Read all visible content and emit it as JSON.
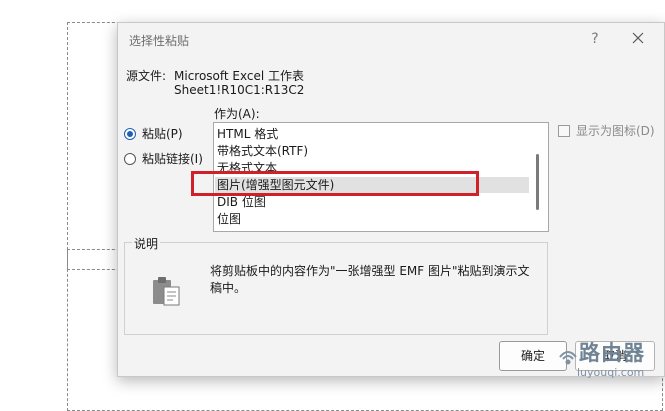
{
  "dialog": {
    "title": "选择性粘贴",
    "help": "?",
    "source_label": "源文件:",
    "source_value": "Microsoft Excel 工作表",
    "source_range": "Sheet1!R10C1:R13C2",
    "as_label": "作为(A):",
    "radios": [
      {
        "label": "粘贴(P)",
        "checked": true
      },
      {
        "label": "粘贴链接(I)",
        "checked": false
      }
    ],
    "list": [
      {
        "label": "HTML 格式",
        "selected": false
      },
      {
        "label": "带格式文本(RTF)",
        "selected": false
      },
      {
        "label": "无格式文本",
        "selected": false
      },
      {
        "label": "图片(增强型图元文件)",
        "selected": true
      },
      {
        "label": "DIB 位图",
        "selected": false
      },
      {
        "label": "位图",
        "selected": false
      }
    ],
    "display_as_icon": "显示为图标(D)",
    "description_label": "说明",
    "description_text": "将剪贴板中的内容作为\"一张增强型 EMF 图片\"粘贴到演示文稿中。",
    "ok": "确定",
    "cancel": "取消"
  },
  "watermark": {
    "text": "路由器",
    "url": "luyouqi.com"
  },
  "colors": {
    "accent": "#1f5fb4",
    "highlight": "#d0202a",
    "dialog_bg": "#f3f3f3"
  }
}
